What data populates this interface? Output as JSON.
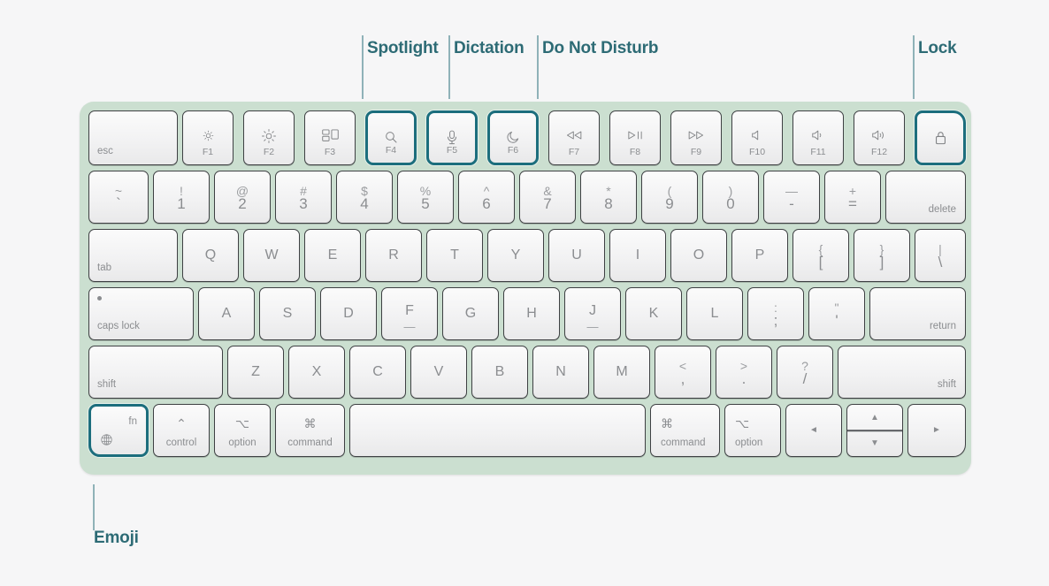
{
  "page": {
    "title": "Magic Keyboard with Touch ID — shortcut callouts",
    "background_color": "#f6f6f7",
    "keyboard_body_color": "#cbdfd0",
    "highlight_color": "#1c6e7d",
    "annotation_text_color": "#2d6b75",
    "annotation_rule_color": "#8fb2b8",
    "key_face_color": "#f2f2f3",
    "key_legend_color": "#8b8d90"
  },
  "annotations": [
    {
      "id": "spotlight",
      "label": "Spotlight",
      "target_key": "F4",
      "position": "top"
    },
    {
      "id": "dictation",
      "label": "Dictation",
      "target_key": "F5",
      "position": "top"
    },
    {
      "id": "do-not-disturb",
      "label": "Do Not Disturb",
      "target_key": "F6",
      "position": "top"
    },
    {
      "id": "lock",
      "label": "Lock",
      "target_key": "lock",
      "position": "top"
    },
    {
      "id": "emoji",
      "label": "Emoji",
      "target_key": "fn",
      "position": "bottom"
    }
  ],
  "keyboard": {
    "rows": [
      {
        "name": "function-row",
        "keys": [
          {
            "name": "esc",
            "style": "word-bl",
            "bottom_left": "esc"
          },
          {
            "name": "f1",
            "style": "fn-icon",
            "icon": "brightness-down-icon",
            "fn": "F1"
          },
          {
            "name": "f2",
            "style": "fn-icon",
            "icon": "brightness-up-icon",
            "fn": "F2"
          },
          {
            "name": "f3",
            "style": "fn-icon",
            "icon": "mission-control-icon",
            "fn": "F3"
          },
          {
            "name": "f4",
            "style": "fn-icon",
            "icon": "search-icon",
            "fn": "F4",
            "highlighted": true
          },
          {
            "name": "f5",
            "style": "fn-icon",
            "icon": "microphone-icon",
            "fn": "F5",
            "highlighted": true
          },
          {
            "name": "f6",
            "style": "fn-icon",
            "icon": "moon-icon",
            "fn": "F6",
            "highlighted": true
          },
          {
            "name": "f7",
            "style": "fn-icon",
            "icon": "rewind-icon",
            "fn": "F7"
          },
          {
            "name": "f8",
            "style": "fn-icon",
            "icon": "play-pause-icon",
            "fn": "F8"
          },
          {
            "name": "f9",
            "style": "fn-icon",
            "icon": "fast-forward-icon",
            "fn": "F9"
          },
          {
            "name": "f10",
            "style": "fn-icon",
            "icon": "volume-mute-icon",
            "fn": "F10"
          },
          {
            "name": "f11",
            "style": "fn-icon",
            "icon": "volume-down-icon",
            "fn": "F11"
          },
          {
            "name": "f12",
            "style": "fn-icon",
            "icon": "volume-up-icon",
            "fn": "F12"
          },
          {
            "name": "lock",
            "style": "icon-only",
            "icon": "lock-icon",
            "highlighted": true
          }
        ]
      },
      {
        "name": "number-row",
        "keys": [
          {
            "name": "backquote",
            "style": "dual",
            "upper": "~",
            "lower": "`"
          },
          {
            "name": "digit-1",
            "style": "dual",
            "upper": "!",
            "lower": "1"
          },
          {
            "name": "digit-2",
            "style": "dual",
            "upper": "@",
            "lower": "2"
          },
          {
            "name": "digit-3",
            "style": "dual",
            "upper": "#",
            "lower": "3"
          },
          {
            "name": "digit-4",
            "style": "dual",
            "upper": "$",
            "lower": "4"
          },
          {
            "name": "digit-5",
            "style": "dual",
            "upper": "%",
            "lower": "5"
          },
          {
            "name": "digit-6",
            "style": "dual",
            "upper": "^",
            "lower": "6"
          },
          {
            "name": "digit-7",
            "style": "dual",
            "upper": "&",
            "lower": "7"
          },
          {
            "name": "digit-8",
            "style": "dual",
            "upper": "*",
            "lower": "8"
          },
          {
            "name": "digit-9",
            "style": "dual",
            "upper": "(",
            "lower": "9"
          },
          {
            "name": "digit-0",
            "style": "dual",
            "upper": ")",
            "lower": "0"
          },
          {
            "name": "minus",
            "style": "dual",
            "upper": "—",
            "lower": "-"
          },
          {
            "name": "equal",
            "style": "dual",
            "upper": "+",
            "lower": "="
          },
          {
            "name": "delete",
            "style": "word-br",
            "bottom_right": "delete"
          }
        ]
      },
      {
        "name": "top-letter-row",
        "keys": [
          {
            "name": "tab",
            "style": "word-bl",
            "bottom_left": "tab"
          },
          {
            "name": "key-q",
            "style": "letter",
            "letter": "Q"
          },
          {
            "name": "key-w",
            "style": "letter",
            "letter": "W"
          },
          {
            "name": "key-e",
            "style": "letter",
            "letter": "E"
          },
          {
            "name": "key-r",
            "style": "letter",
            "letter": "R"
          },
          {
            "name": "key-t",
            "style": "letter",
            "letter": "T"
          },
          {
            "name": "key-y",
            "style": "letter",
            "letter": "Y"
          },
          {
            "name": "key-u",
            "style": "letter",
            "letter": "U"
          },
          {
            "name": "key-i",
            "style": "letter",
            "letter": "I"
          },
          {
            "name": "key-o",
            "style": "letter",
            "letter": "O"
          },
          {
            "name": "key-p",
            "style": "letter",
            "letter": "P"
          },
          {
            "name": "bracket-left",
            "style": "dual",
            "upper": "{",
            "lower": "["
          },
          {
            "name": "bracket-right",
            "style": "dual",
            "upper": "}",
            "lower": "]"
          },
          {
            "name": "backslash",
            "style": "dual",
            "upper": "|",
            "lower": "\\"
          }
        ]
      },
      {
        "name": "home-row",
        "keys": [
          {
            "name": "caps-lock",
            "style": "caps",
            "bottom_left": "caps lock"
          },
          {
            "name": "key-a",
            "style": "letter",
            "letter": "A"
          },
          {
            "name": "key-s",
            "style": "letter",
            "letter": "S"
          },
          {
            "name": "key-d",
            "style": "letter",
            "letter": "D"
          },
          {
            "name": "key-f",
            "style": "letter",
            "letter": "F",
            "homing": true
          },
          {
            "name": "key-g",
            "style": "letter",
            "letter": "G"
          },
          {
            "name": "key-h",
            "style": "letter",
            "letter": "H"
          },
          {
            "name": "key-j",
            "style": "letter",
            "letter": "J",
            "homing": true
          },
          {
            "name": "key-k",
            "style": "letter",
            "letter": "K"
          },
          {
            "name": "key-l",
            "style": "letter",
            "letter": "L"
          },
          {
            "name": "semicolon",
            "style": "dual",
            "upper": ":",
            "lower": ";"
          },
          {
            "name": "quote",
            "style": "dual",
            "upper": "\"",
            "lower": "'"
          },
          {
            "name": "return",
            "style": "word-br",
            "bottom_right": "return"
          }
        ]
      },
      {
        "name": "shift-row",
        "keys": [
          {
            "name": "shift-left",
            "style": "word-bl",
            "bottom_left": "shift"
          },
          {
            "name": "key-z",
            "style": "letter",
            "letter": "Z"
          },
          {
            "name": "key-x",
            "style": "letter",
            "letter": "X"
          },
          {
            "name": "key-c",
            "style": "letter",
            "letter": "C"
          },
          {
            "name": "key-v",
            "style": "letter",
            "letter": "V"
          },
          {
            "name": "key-b",
            "style": "letter",
            "letter": "B"
          },
          {
            "name": "key-n",
            "style": "letter",
            "letter": "N"
          },
          {
            "name": "key-m",
            "style": "letter",
            "letter": "M"
          },
          {
            "name": "comma",
            "style": "dual",
            "upper": "<",
            "lower": ","
          },
          {
            "name": "period",
            "style": "dual",
            "upper": ">",
            "lower": "."
          },
          {
            "name": "slash",
            "style": "dual",
            "upper": "?",
            "lower": "/"
          },
          {
            "name": "shift-right",
            "style": "word-br",
            "bottom_right": "shift"
          }
        ]
      },
      {
        "name": "modifier-row",
        "keys": [
          {
            "name": "fn",
            "style": "fn-globe",
            "top_right": "fn",
            "icon": "globe-icon",
            "highlighted": true
          },
          {
            "name": "control",
            "style": "modifier",
            "symbol": "⌃",
            "word": "control"
          },
          {
            "name": "option-left",
            "style": "modifier",
            "symbol": "⌥",
            "word": "option"
          },
          {
            "name": "command-left",
            "style": "modifier",
            "symbol": "⌘",
            "word": "command"
          },
          {
            "name": "space",
            "style": "blank"
          },
          {
            "name": "command-right",
            "style": "modifier-left",
            "symbol": "⌘",
            "word": "command"
          },
          {
            "name": "option-right",
            "style": "modifier-left",
            "symbol": "⌥",
            "word": "option"
          },
          {
            "name": "arrow-left",
            "style": "icon-only",
            "icon": "arrow-left-icon"
          },
          {
            "name": "arrow-up-down",
            "style": "split",
            "icon_up": "arrow-up-icon",
            "icon_down": "arrow-down-icon"
          },
          {
            "name": "arrow-right",
            "style": "icon-only",
            "icon": "arrow-right-icon"
          }
        ]
      }
    ]
  }
}
